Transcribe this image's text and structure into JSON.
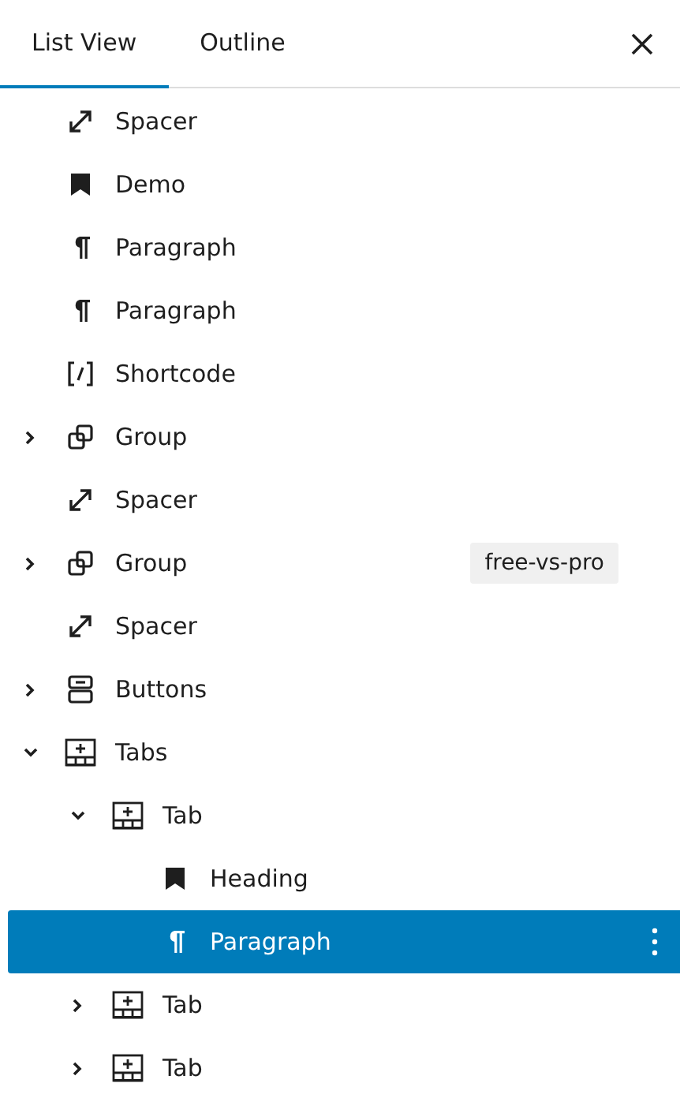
{
  "tabs": [
    {
      "label": "List View",
      "selected": true
    },
    {
      "label": "Outline",
      "selected": false
    }
  ],
  "tree": [
    {
      "label": "Spacer",
      "kind": "spacer",
      "selected": false
    },
    {
      "label": "Demo",
      "kind": "bookmark",
      "selected": false
    },
    {
      "label": "Paragraph",
      "kind": "paragraph",
      "selected": false
    },
    {
      "label": "Paragraph",
      "kind": "paragraph",
      "selected": false
    },
    {
      "label": "Shortcode",
      "kind": "shortcode",
      "selected": false
    },
    {
      "label": "Group",
      "kind": "group",
      "expanded": false,
      "selected": false
    },
    {
      "label": "Spacer",
      "kind": "spacer",
      "selected": false
    },
    {
      "label": "Group",
      "kind": "group",
      "expanded": false,
      "selected": false,
      "tag": "free-vs-pro"
    },
    {
      "label": "Spacer",
      "kind": "spacer",
      "selected": false
    },
    {
      "label": "Buttons",
      "kind": "buttons",
      "expanded": false,
      "selected": false
    },
    {
      "label": "Tabs",
      "kind": "tabs",
      "expanded": true,
      "selected": false,
      "children": [
        {
          "label": "Tab",
          "kind": "tabs",
          "expanded": true,
          "selected": false,
          "children": [
            {
              "label": "Heading",
              "kind": "bookmark",
              "selected": false
            },
            {
              "label": "Paragraph",
              "kind": "paragraph",
              "selected": true
            }
          ]
        },
        {
          "label": "Tab",
          "kind": "tabs",
          "expanded": false,
          "selected": false
        },
        {
          "label": "Tab",
          "kind": "tabs",
          "expanded": false,
          "selected": false
        }
      ]
    }
  ]
}
